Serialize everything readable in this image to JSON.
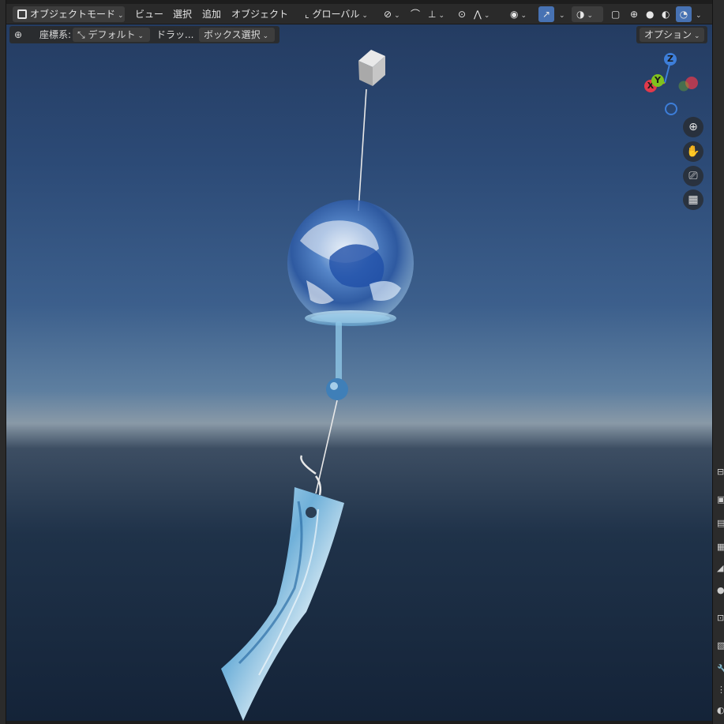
{
  "header": {
    "mode_label": "オブジェクトモード",
    "menu_view": "ビュー",
    "menu_select": "選択",
    "menu_add": "追加",
    "menu_object": "オブジェクト",
    "transform_orientation": "グローバル"
  },
  "toolbar": {
    "coord_label": "座標系:",
    "coord_value": "デフォルト",
    "drag_label": "ドラッ...",
    "drag_value": "ボックス選択",
    "options_label": "オプション"
  },
  "gizmo": {
    "x_label": "X",
    "y_label": "Y",
    "z_label": "Z",
    "x_color": "#e2394b",
    "y_color": "#80c21d",
    "z_color": "#3d7ed9"
  },
  "icons": {
    "zoom": "zoom-icon",
    "pan": "hand-icon",
    "camera": "camera-icon",
    "perspective": "grid-icon"
  },
  "colors": {
    "header_bg": "#2a2a2a",
    "accent": "#4772b3",
    "viewport_top": "#233a5f",
    "horizon": "#8999a7"
  }
}
